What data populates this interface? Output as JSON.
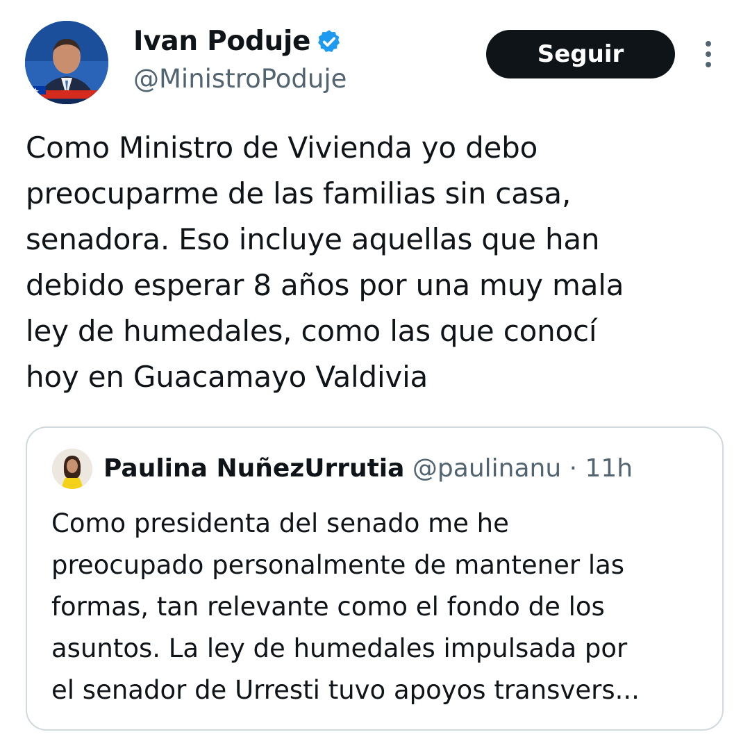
{
  "author": {
    "display_name": "Ivan Poduje",
    "handle": "@MinistroPoduje",
    "avatar_icon": "profile-photo",
    "verified_icon": "verified-badge-icon",
    "verified_color": "#1d9bf0"
  },
  "header": {
    "follow_label": "Seguir",
    "more_icon": "more-options-icon"
  },
  "tweet": {
    "text": "Como Ministro de Vivienda yo debo\npreocuparme de las familias sin casa,\nsenadora. Eso incluye aquellas que han\ndebido esperar 8 años por una muy mala\nley de humedales, como las que conocí\nhoy en Guacamayo Valdivia"
  },
  "quote": {
    "display_name": "Paulina NuñezUrrutia",
    "handle": "@paulinanu",
    "separator": " · ",
    "time": "11h",
    "text": "Como presidenta del senado me he\npreocupado personalmente de mantener las\nformas, tan relevante como el fondo de los\nasuntos. La ley de humedales impulsada por\nel senador de Urresti tuvo apoyos transvers..."
  },
  "colors": {
    "text_primary": "#0f1419",
    "text_secondary": "#536471",
    "button_bg": "#0f1419",
    "border": "#cfd9de"
  }
}
